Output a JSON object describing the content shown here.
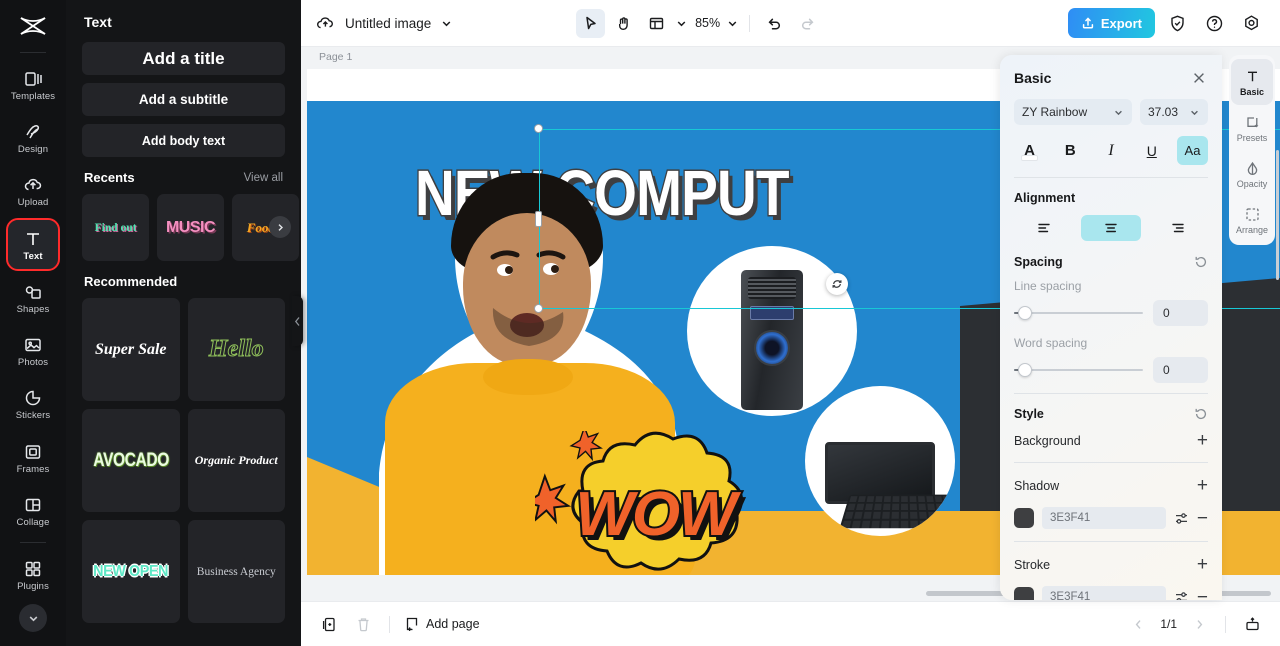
{
  "rail": {
    "logo": "capcut-logo",
    "items": [
      {
        "label": "Templates",
        "icon": "templates-icon"
      },
      {
        "label": "Design",
        "icon": "design-icon"
      },
      {
        "label": "Upload",
        "icon": "upload-icon"
      },
      {
        "label": "Text",
        "icon": "text-icon"
      },
      {
        "label": "Shapes",
        "icon": "shapes-icon"
      },
      {
        "label": "Photos",
        "icon": "photos-icon"
      },
      {
        "label": "Stickers",
        "icon": "stickers-icon"
      },
      {
        "label": "Frames",
        "icon": "frames-icon"
      },
      {
        "label": "Collage",
        "icon": "collage-icon"
      },
      {
        "label": "Plugins",
        "icon": "plugins-icon"
      }
    ],
    "collapse_icon": "chevron-down-icon"
  },
  "panel": {
    "title": "Text",
    "buttons": [
      {
        "label": "Add a title"
      },
      {
        "label": "Add a subtitle"
      },
      {
        "label": "Add body text"
      }
    ],
    "recents": {
      "title": "Recents",
      "view_all": "View all",
      "items": [
        {
          "label": "Find out"
        },
        {
          "label": "MUSIC"
        },
        {
          "label": "Foodie"
        }
      ],
      "next_icon": "chevron-right-icon"
    },
    "recommended": {
      "title": "Recommended",
      "items": [
        {
          "label": "Super Sale"
        },
        {
          "label": "Hello"
        },
        {
          "label": "AVOCADO"
        },
        {
          "label": "Organic Product"
        },
        {
          "label": "NEW OPEN"
        },
        {
          "label": "Business Agency"
        }
      ]
    }
  },
  "topbar": {
    "cloud_icon": "cloud-sync-icon",
    "doc_name": "Untitled image",
    "doc_caret": "chevron-down-icon",
    "tools": [
      {
        "name": "select-tool",
        "icon": "cursor-icon",
        "active": true
      },
      {
        "name": "hand-tool",
        "icon": "hand-icon",
        "active": false
      },
      {
        "name": "layout-tool",
        "icon": "layout-icon",
        "active": false
      }
    ],
    "layout_caret": "chevron-down-icon",
    "zoom": "85%",
    "zoom_caret": "chevron-down-icon",
    "undo_icon": "undo-icon",
    "redo_icon": "redo-icon",
    "export_label": "Export",
    "export_icon": "export-upload-icon",
    "export_color": "#23b8e0",
    "shield_icon": "shield-icon",
    "help_icon": "help-circle-icon",
    "settings_icon": "settings-gear-icon"
  },
  "canvas": {
    "page_label": "Page 1",
    "headline": "NEW COMPUT",
    "badge": "WOW",
    "background_color": "#2287ce",
    "accent_color": "#f2b330",
    "selection_color": "#18c8d6",
    "float_toolbar": {
      "ai_icon": "ai-magic-pen-icon",
      "ai_caret": "chevron-down-icon",
      "duplicate_icon": "duplicate-icon",
      "more_icon": "more-horizontal-icon"
    },
    "rotate_icon": "rotate-icon"
  },
  "bottombar": {
    "duplicate_page_icon": "duplicate-page-icon",
    "delete_page_icon": "trash-icon",
    "add_page_label": "Add page",
    "add_page_icon": "add-page-icon",
    "prev_icon": "chevron-left-icon",
    "page_indicator": "1/1",
    "next_icon": "chevron-right-icon",
    "present_icon": "present-icon"
  },
  "props": {
    "title": "Basic",
    "close_icon": "close-icon",
    "font_family": "ZY Rainbow",
    "font_size": "37.03",
    "format_buttons": [
      {
        "name": "text-color-button",
        "label": "A",
        "active": false
      },
      {
        "name": "bold-button",
        "label": "B",
        "active": false
      },
      {
        "name": "italic-button",
        "label": "I",
        "active": false
      },
      {
        "name": "underline-button",
        "label": "U",
        "active": false
      },
      {
        "name": "case-button",
        "label": "Aa",
        "active": true
      }
    ],
    "alignment": {
      "title": "Alignment",
      "options": [
        {
          "name": "align-left",
          "active": false
        },
        {
          "name": "align-center",
          "active": true
        },
        {
          "name": "align-right",
          "active": false
        }
      ]
    },
    "spacing": {
      "title": "Spacing",
      "reset_icon": "reset-icon",
      "line_spacing_label": "Line spacing",
      "line_spacing_value": "0",
      "word_spacing_label": "Word spacing",
      "word_spacing_value": "0"
    },
    "style": {
      "title": "Style",
      "reset_icon": "reset-icon",
      "background_label": "Background",
      "shadow_label": "Shadow",
      "shadow_color": "3E3F41",
      "shadow_swatch": "#3e3f41",
      "stroke_label": "Stroke",
      "stroke_color": "3E3F41",
      "stroke_swatch": "#3e3f41",
      "settings_icon": "sliders-icon",
      "add_icon": "plus-icon",
      "remove_icon": "minus-icon"
    }
  },
  "vtabs": {
    "items": [
      {
        "label": "Basic",
        "icon": "text-t-icon",
        "active": true
      },
      {
        "label": "Presets",
        "icon": "presets-icon",
        "active": false
      },
      {
        "label": "Opacity",
        "icon": "opacity-drop-icon",
        "active": false
      },
      {
        "label": "Arrange",
        "icon": "arrange-icon",
        "active": false
      }
    ]
  }
}
